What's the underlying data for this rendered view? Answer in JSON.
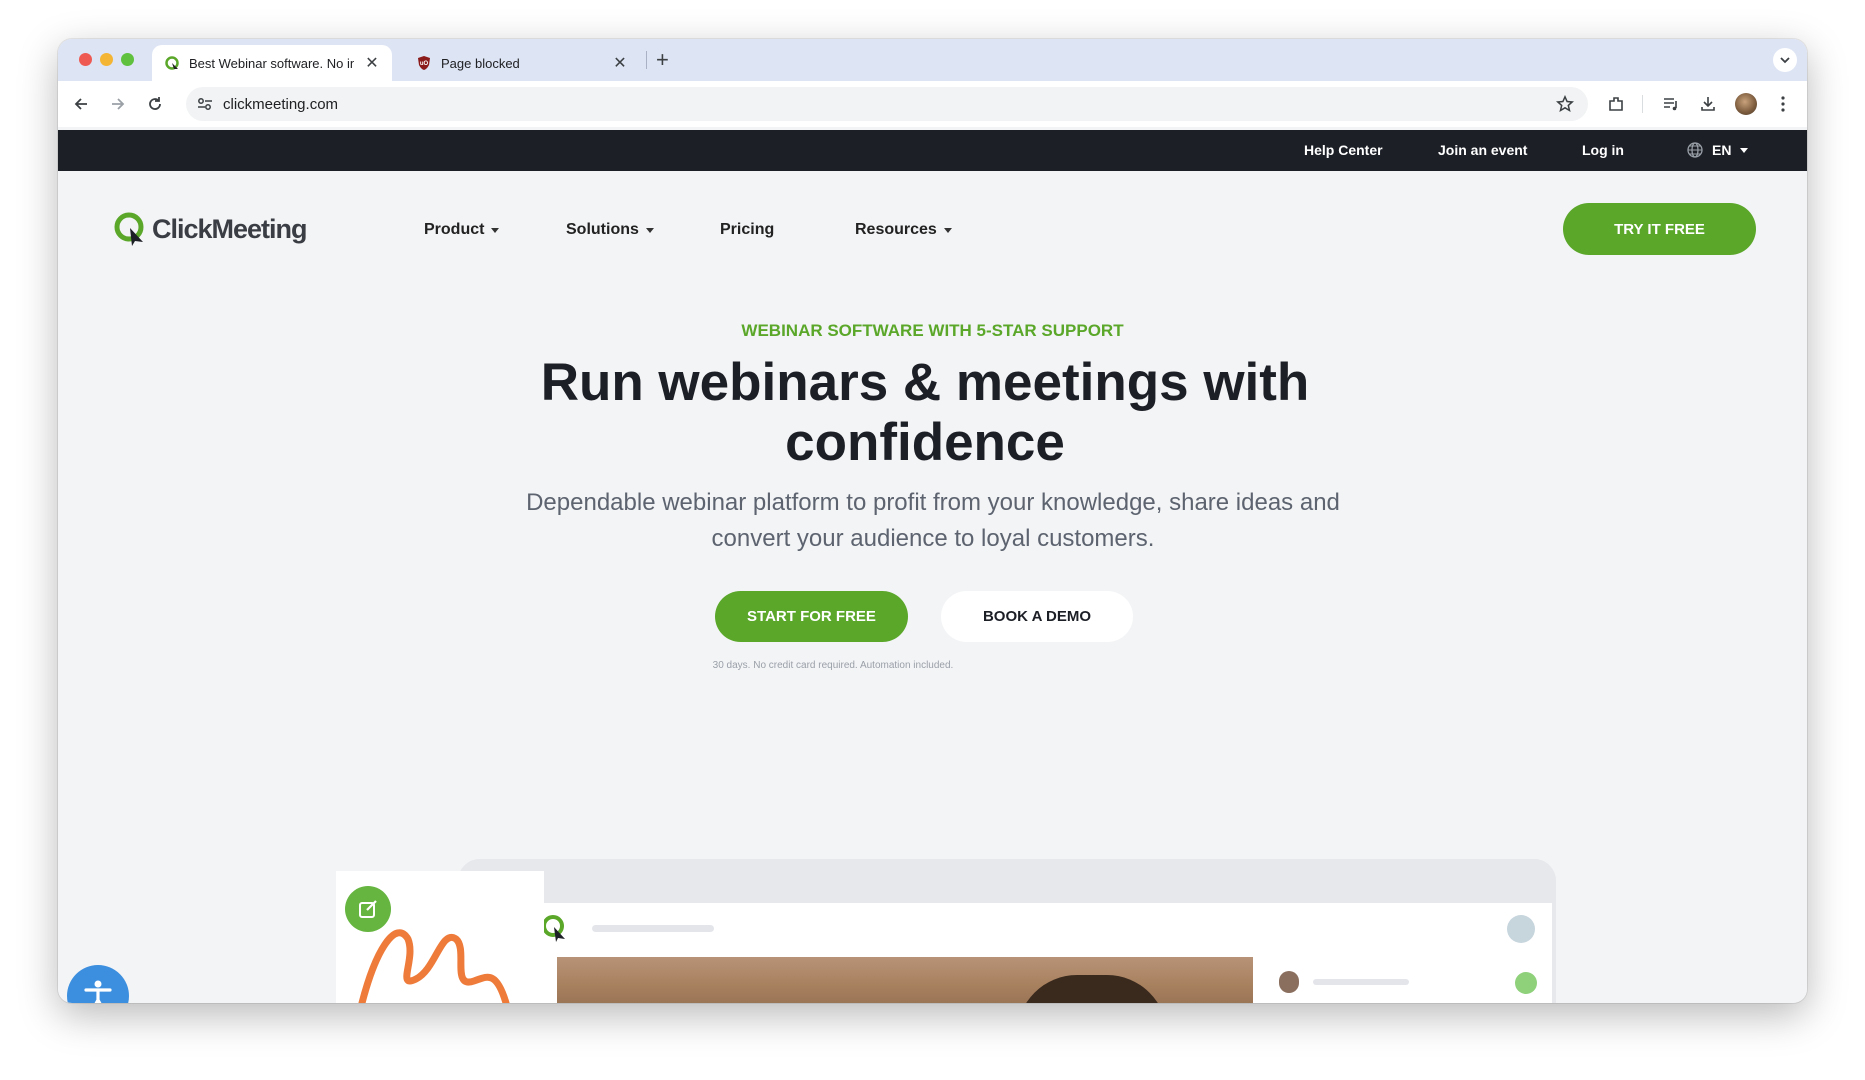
{
  "browser": {
    "tabs": [
      {
        "title": "Best Webinar software. No in",
        "active": true
      },
      {
        "title": "Page blocked",
        "active": false
      }
    ],
    "url": "clickmeeting.com"
  },
  "topbar": {
    "help_center": "Help Center",
    "join_event": "Join an event",
    "log_in": "Log in",
    "language": "EN"
  },
  "nav": {
    "logo_text": "ClickMeeting",
    "product": "Product",
    "solutions": "Solutions",
    "pricing": "Pricing",
    "resources": "Resources",
    "try_free": "TRY IT FREE"
  },
  "hero": {
    "eyebrow": "WEBINAR SOFTWARE WITH 5-STAR SUPPORT",
    "headline": "Run webinars & meetings with confidence",
    "subheadline": "Dependable webinar platform to profit from your knowledge, share ideas and convert your audience to loyal customers.",
    "start_free": "START FOR FREE",
    "book_demo": "BOOK A DEMO",
    "note": "30 days. No credit card required. Automation included."
  },
  "colors": {
    "brand_green": "#5aa72a",
    "dark": "#1c1f26",
    "accessibility_blue": "#3c8fde"
  },
  "icons": [
    "back-icon",
    "forward-icon",
    "reload-icon",
    "site-info-icon",
    "star-icon",
    "extensions-icon",
    "media-icon",
    "download-icon",
    "profile-avatar",
    "menu-icon",
    "globe-icon",
    "accessibility-icon",
    "edit-icon"
  ]
}
